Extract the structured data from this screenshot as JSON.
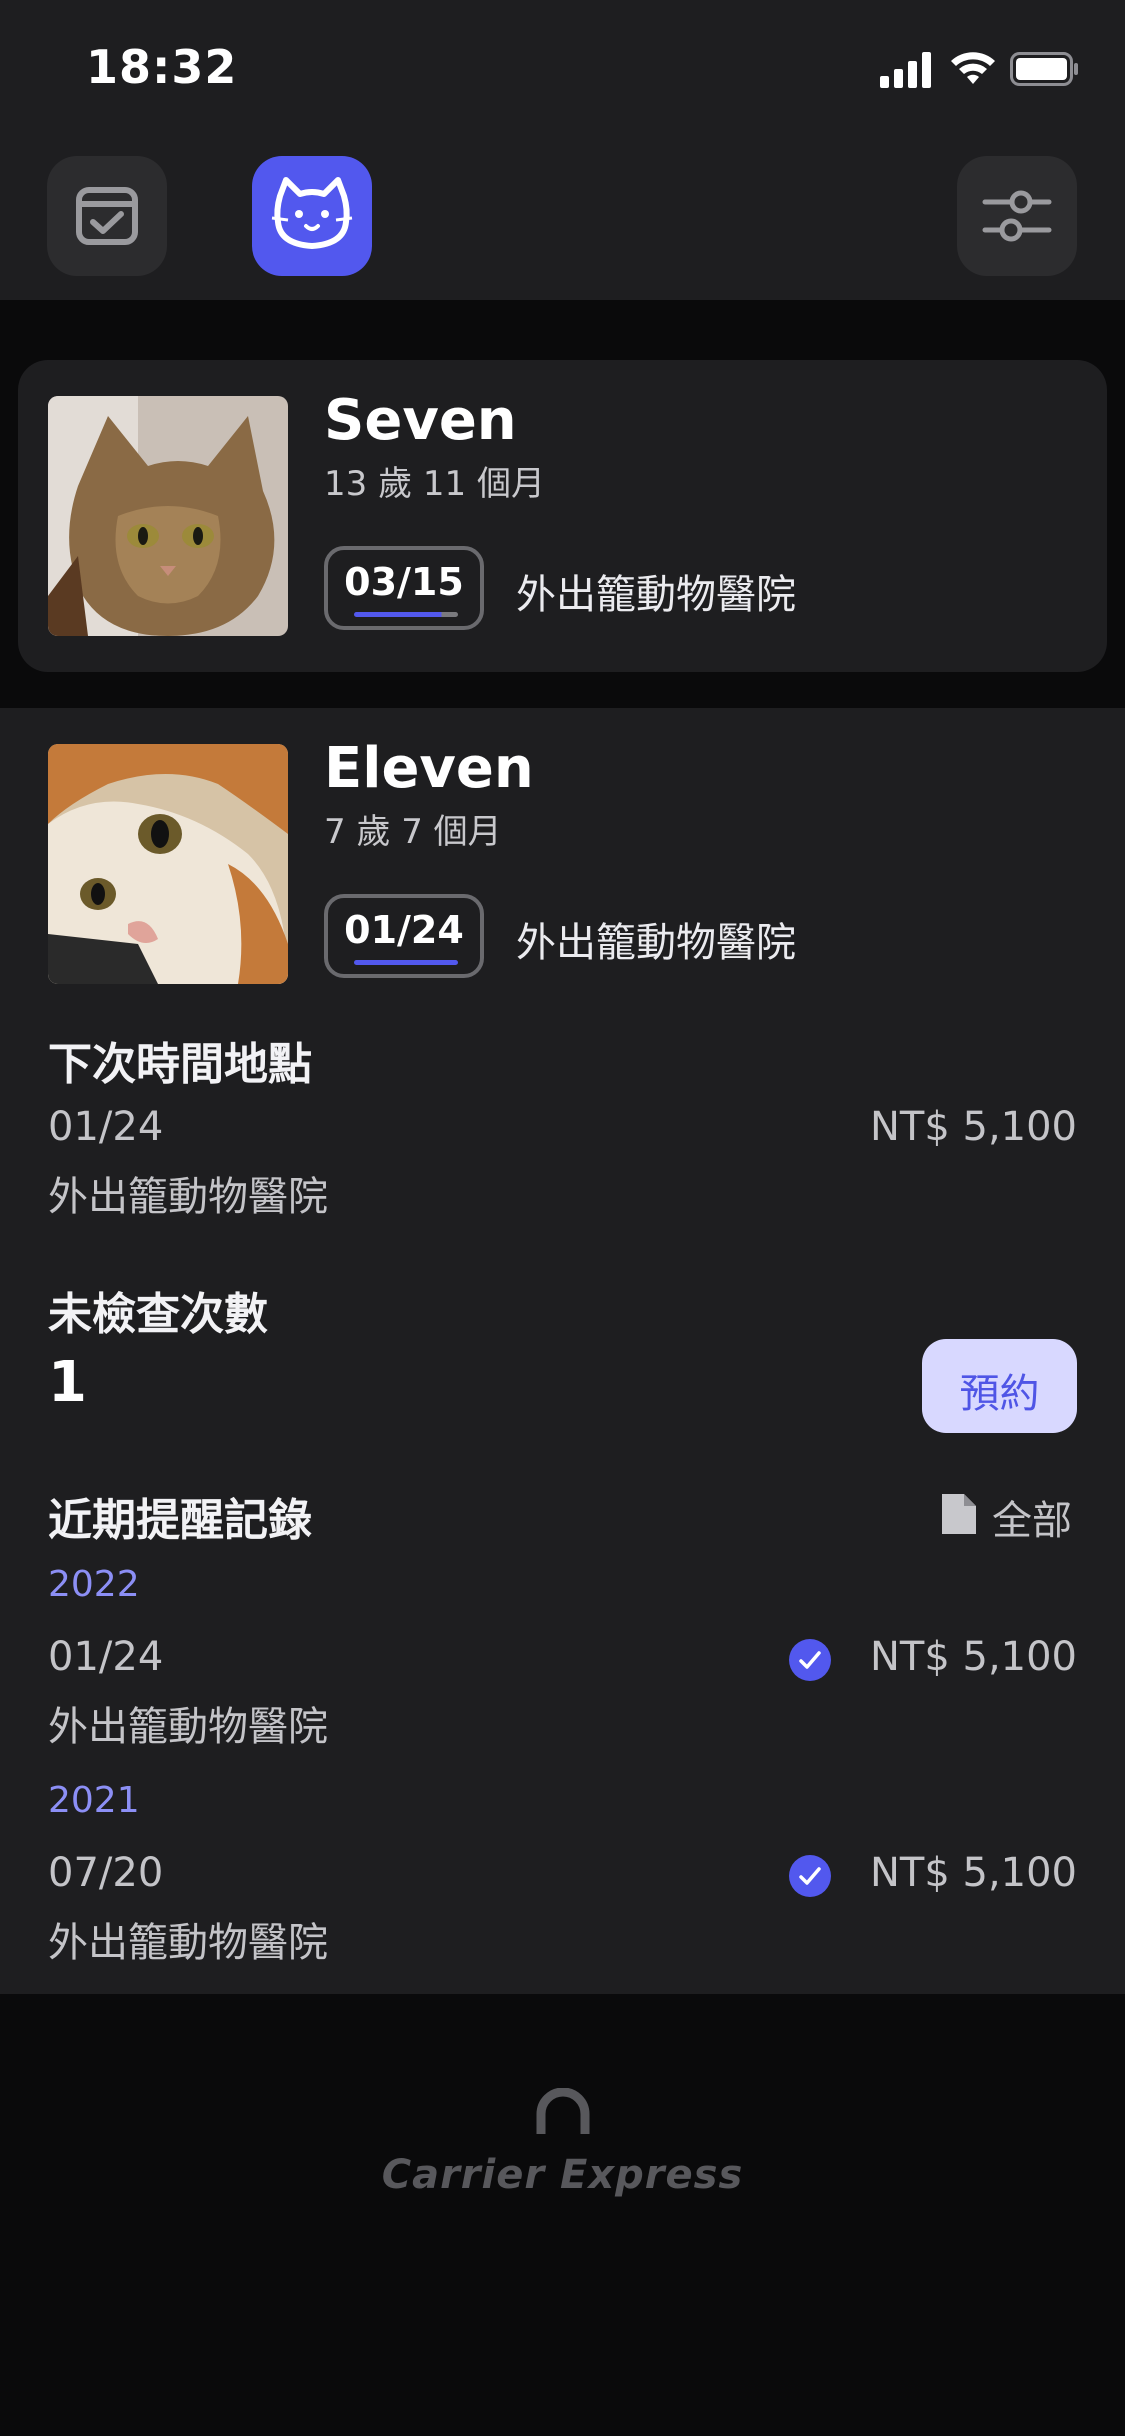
{
  "status_bar": {
    "time": "18:32"
  },
  "header": {
    "buttons": [
      {
        "name": "calendar-check-icon"
      },
      {
        "name": "cat-icon",
        "active": true
      },
      {
        "name": "filter-sliders-icon"
      }
    ],
    "accent_color": "#5258EE"
  },
  "pets": [
    {
      "name": "Seven",
      "age": "13 歲 11 個月",
      "next_date": "03/15",
      "clinic": "外出籠動物醫院"
    },
    {
      "name": "Eleven",
      "age": "7 歲 7 個月",
      "next_date": "01/24",
      "clinic": "外出籠動物醫院"
    }
  ],
  "detail": {
    "next_title": "下次時間地點",
    "next_date": "01/24",
    "next_clinic": "外出籠動物醫院",
    "next_price": "NT$ 5,100",
    "unchecked_title": "未檢查次數",
    "unchecked_count": "1",
    "book_label": "預約",
    "recent_title": "近期提醒記錄",
    "all_label": "全部",
    "records": [
      {
        "year": "2022",
        "date": "01/24",
        "clinic": "外出籠動物醫院",
        "price": "NT$ 5,100",
        "done": true
      },
      {
        "year": "2021",
        "date": "07/20",
        "clinic": "外出籠動物醫院",
        "price": "NT$ 5,100",
        "done": true
      }
    ]
  },
  "footer": {
    "brand": "Carrier Express"
  }
}
